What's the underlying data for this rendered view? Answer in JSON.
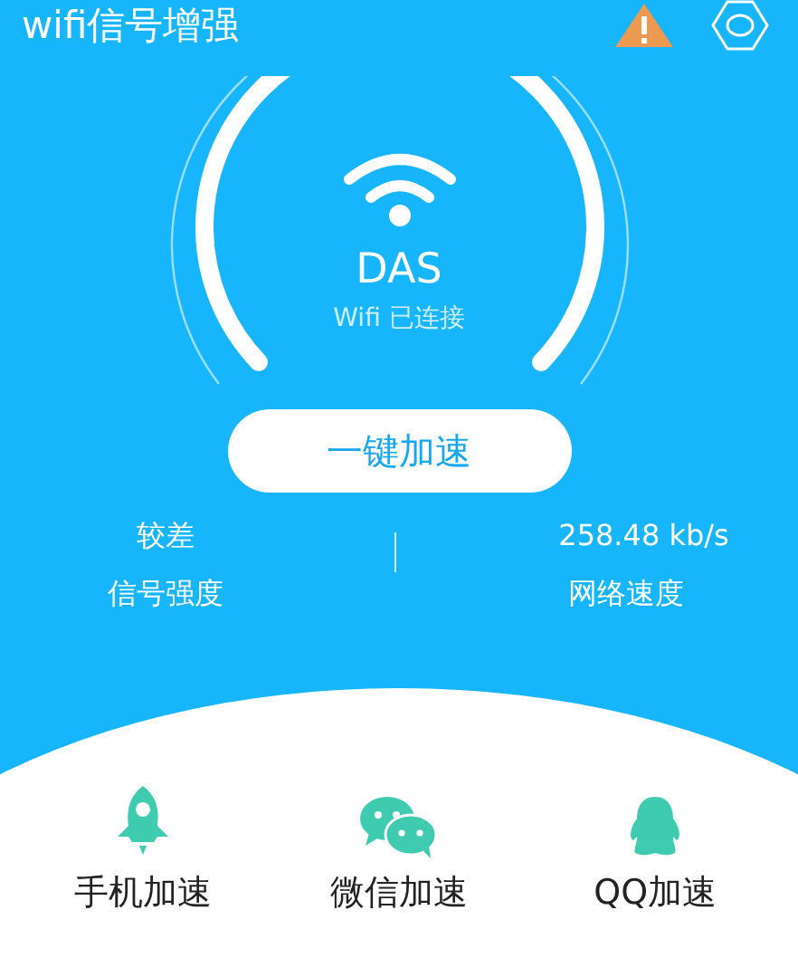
{
  "title": "wifi信号增强",
  "network": {
    "ssid": "DAS",
    "status": "Wifi 已连接"
  },
  "boost_button": "一键加速",
  "stats": [
    {
      "value": "较差",
      "label": "信号强度"
    },
    {
      "value": "258.48 kb/s",
      "label": "网络速度"
    }
  ],
  "shortcuts": [
    {
      "kind": "rocket",
      "label": "手机加速"
    },
    {
      "kind": "chat",
      "label": "微信加速"
    },
    {
      "kind": "penguin",
      "label": "QQ加速"
    }
  ]
}
